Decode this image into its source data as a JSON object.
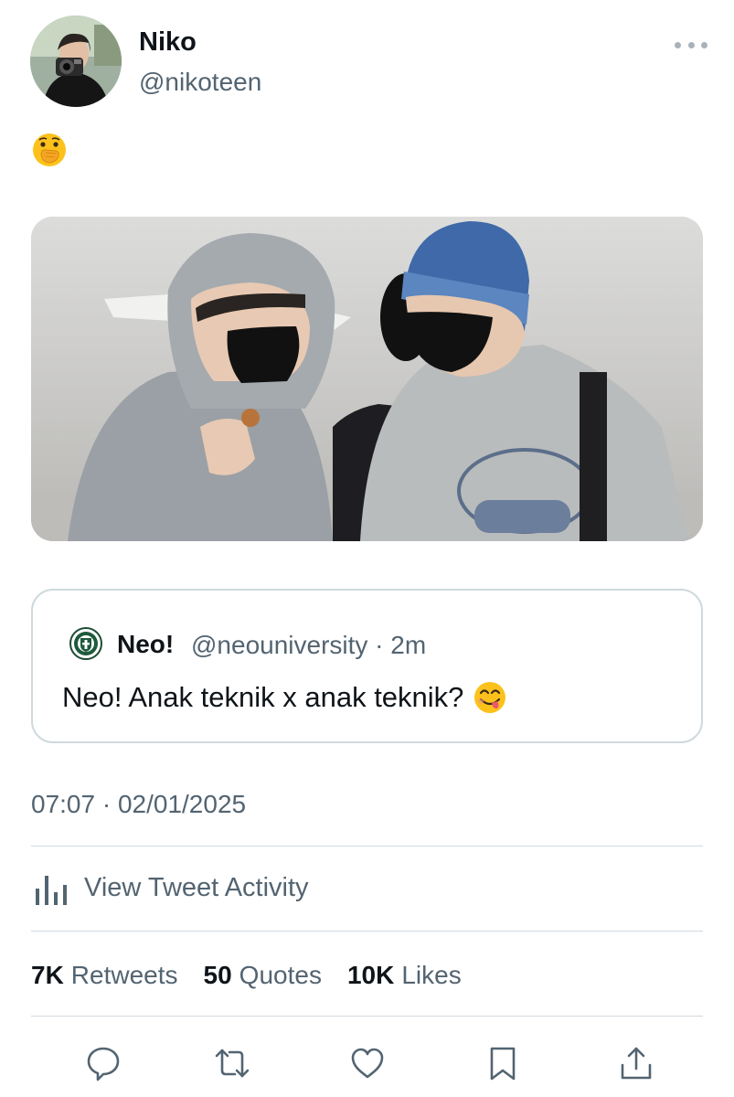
{
  "author": {
    "name": "Niko",
    "handle": "@nikoteen"
  },
  "tweet": {
    "emoji_icon": "face-with-hand-over-mouth-emoji"
  },
  "quote": {
    "name": "Neo!",
    "handle": "@neouniversity",
    "separator": " · ",
    "time": "2m",
    "text": "Neo! Anak teknik x anak teknik?",
    "emoji_icon": "face-savoring-food-emoji"
  },
  "timestamp": "07:07 · 02/01/2025",
  "activity_label": "View Tweet Activity",
  "stats": {
    "retweets_count": "7K",
    "retweets_label": "Retweets",
    "quotes_count": "50",
    "quotes_label": "Quotes",
    "likes_count": "10K",
    "likes_label": "Likes"
  },
  "actions": [
    "reply-icon",
    "retweet-icon",
    "like-icon",
    "bookmark-icon",
    "share-icon"
  ],
  "colors": {
    "primary_text": "#0f1419",
    "secondary_text": "#536471",
    "border": "#cfd9de"
  }
}
